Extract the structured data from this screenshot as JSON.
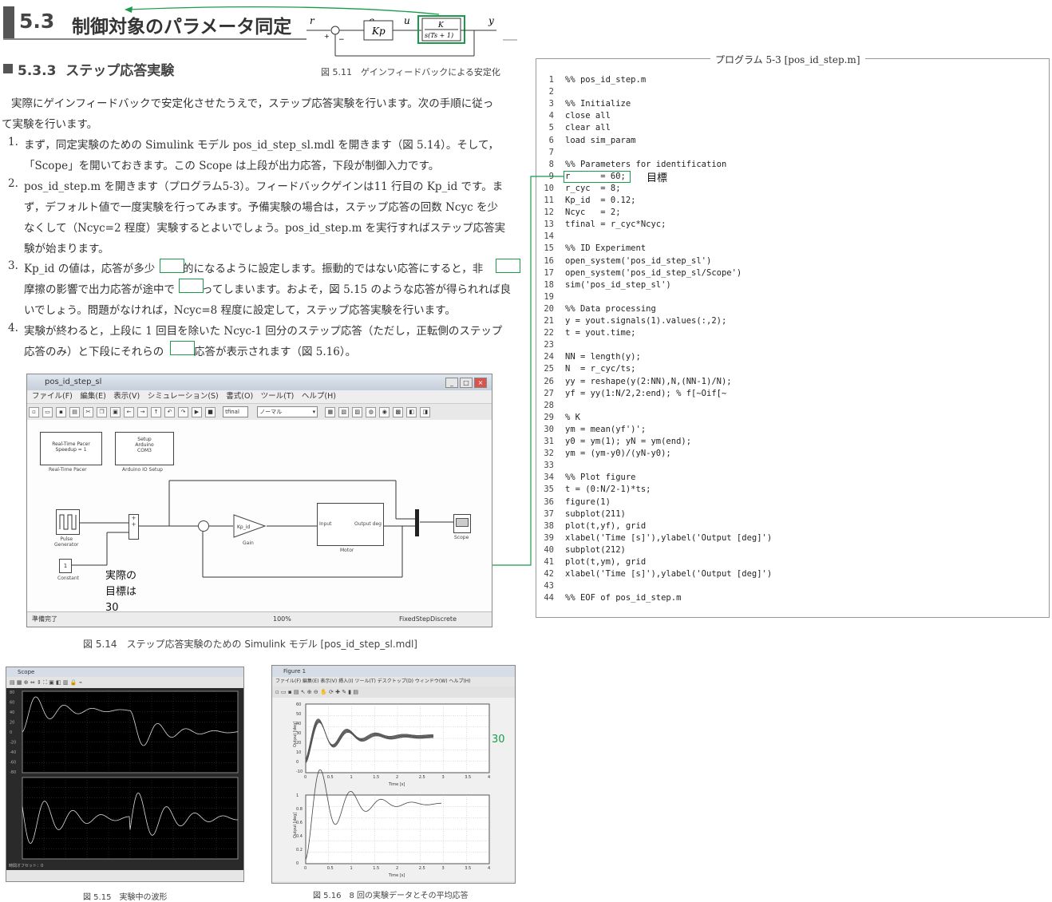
{
  "header": {
    "section_number": "5.3",
    "section_title": "制御対象のパラメータ同定"
  },
  "subsection": {
    "number": "5.3.3",
    "title": "ステップ応答実験"
  },
  "block_diagram": {
    "labels": {
      "r": "r",
      "e": "e",
      "u": "u",
      "y": "y",
      "plus": "+",
      "minus": "−",
      "kp": "Kp",
      "plant_num": "K",
      "plant_den": "s(Ts + 1)"
    },
    "caption": "図 5.11　ゲインフィードバックによる安定化"
  },
  "body": {
    "intro_1": "実際にゲインフィードバックで安定化させたうえで，ステップ応答実験を行います。次の手順に従っ",
    "intro_2": "て実験を行います。",
    "items": [
      {
        "n": "1.",
        "l1": "まず，同定実験のための Simulink モデル pos_id_step_sl.mdl を開きます（図 5.14）。そして，",
        "l2": "「Scope」を開いておきます。この Scope は上段が出力応答，下段が制御入力です。"
      },
      {
        "n": "2.",
        "l1": "pos_id_step.m を開きます（プログラム5-3）。フィードバックゲインは11 行目の Kp_id です。ま",
        "l2": "ず，デフォルト値で一度実験を行ってみます。予備実験の場合は，ステップ応答の回数 Ncyc を少",
        "l3": "なくして（Ncyc=2 程度）実験するとよいでしょう。pos_id_step.m を実行すればステップ応答実",
        "l4": "験が始まります。"
      },
      {
        "n": "3.",
        "l1a": "Kp_id の値は，応答が多少",
        "l1b": "的になるように設定します。振動的ではない応答にすると，非",
        "l2a": "摩擦の影響で出力応答が途中で",
        "l2b": "ってしまいます。およそ，図 5.15 のような応答が得られれば良",
        "l3": "いでしょう。問題がなければ，Ncyc=8 程度に設定して，ステップ応答実験を行います。"
      },
      {
        "n": "4.",
        "l1": "実験が終わると，上段に 1 回目を除いた Ncyc-1 回分のステップ応答（ただし，正転側のステップ",
        "l2a": "応答のみ）と下段にそれらの",
        "l2b": "応答が表示されます（図 5.16）。"
      }
    ]
  },
  "code": {
    "title": "プログラム 5-3 [pos_id_step.m]",
    "lines": [
      "%% pos_id_step.m",
      "",
      "%% Initialize",
      "close all",
      "clear all",
      "load sim_param",
      "",
      "%% Parameters for identification",
      "r      = 60;",
      "r_cyc  = 8;",
      "Kp_id  = 0.12;",
      "Ncyc   = 2;",
      "tfinal = r_cyc*Ncyc;",
      "",
      "%% ID Experiment",
      "open_system('pos_id_step_sl')",
      "open_system('pos_id_step_sl/Scope')",
      "sim('pos_id_step_sl')",
      "",
      "%% Data processing",
      "y = yout.signals(1).values(:,2);",
      "t = yout.time;",
      "",
      "NN = length(y);",
      "N  = r_cyc/ts;",
      "yy = reshape(y(2:NN),N,(NN-1)/N);",
      "yf = yy(1:N/2,2:end); % f[~Oif[~",
      "",
      "% K",
      "ym = mean(yf')';",
      "y0 = ym(1); yN = ym(end);",
      "ym = (ym-y0)/(yN-y0);",
      "",
      "%% Plot figure",
      "t = (0:N/2-1)*ts;",
      "figure(1)",
      "subplot(211)",
      "plot(t,yf), grid",
      "xlabel('Time [s]'),ylabel('Output [deg]')",
      "subplot(212)",
      "plot(t,ym), grid",
      "xlabel('Time [s]'),ylabel('Output [deg]')",
      "",
      "%% EOF of pos_id_step.m"
    ]
  },
  "annotations": {
    "target_note": "目標",
    "actual_note_1": "実際の",
    "actual_note_2": "目標は",
    "actual_note_3": "30",
    "fig_note_30": "30"
  },
  "simulink": {
    "title": "pos_id_step_sl",
    "menu": "ファイル(F)　編集(E)　表示(V)　シミュレーション(S)　書式(O)　ツール(T)　ヘルプ(H)",
    "stop_time": "tfinal",
    "mode": "ノーマル",
    "blocks": {
      "pacer": "Real-Time Pacer\nSpeedup = 1",
      "pacer_label": "Real-Time Pacer",
      "setup": "Setup\nArduino\nCOM3",
      "setup_label": "Arduino IO Setup",
      "pulse_label": "Pulse\nGenerator",
      "constant_label": "Constant",
      "gain": "Kp_id",
      "gain_label": "Gain",
      "motor_in": "Input",
      "motor_out": "Output deg",
      "motor_label": "Motor",
      "scope_label": "Scope"
    },
    "status": "準備完了",
    "zoom": "100%",
    "solver": "FixedStepDiscrete",
    "caption": "図 5.14　ステップ応答実験のための Simulink モデル [pos_id_step_sl.mdl]"
  },
  "scope": {
    "title": "Scope",
    "y_ticks_top": [
      "80",
      "60",
      "40",
      "20",
      "0",
      "-20",
      "-40",
      "-60",
      "-80"
    ],
    "footer": "時間オフセット：0",
    "caption": "図 5.15　実験中の波形"
  },
  "figure": {
    "title": "Figure 1",
    "menu": "ファイル(F) 編集(E) 表示(V) 挿入(I) ツール(T) デスクトップ(D) ウィンドウ(W) ヘルプ(H)",
    "ylabel": "Output [deg]",
    "xlabel": "Time [s]",
    "x_ticks": [
      "0",
      "0.5",
      "1",
      "1.5",
      "2",
      "2.5",
      "3",
      "3.5",
      "4"
    ],
    "y_ticks_top": [
      "60",
      "50",
      "40",
      "30",
      "20",
      "10",
      "0",
      "-10"
    ],
    "y_ticks_bottom": [
      "1",
      "0.8",
      "0.6",
      "0.4",
      "0.2",
      "0"
    ],
    "caption": "図 5.16　8 回の実験データとその平均応答"
  }
}
